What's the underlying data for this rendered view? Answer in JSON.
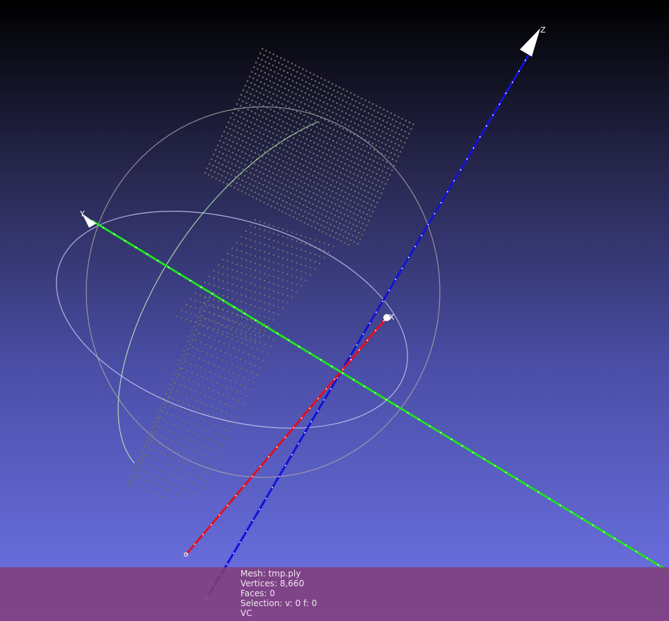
{
  "viewport": {
    "background_top": "#000000",
    "background_bottom": "#6f74e8"
  },
  "axes": {
    "x": {
      "label": "X",
      "color": "#e01020"
    },
    "y": {
      "label": "Y",
      "color": "#20e020"
    },
    "z": {
      "label": "Z",
      "color": "#1010d0"
    }
  },
  "trackball": {
    "ring_color": "#c8c8c8"
  },
  "point_cloud": {
    "color": "#707068"
  },
  "info": {
    "mesh": "Mesh: tmp.ply",
    "vertices": "Vertices: 8,660",
    "faces": "Faces: 0",
    "selection": "Selection: v: 0 f: 0",
    "mode": "VC"
  }
}
